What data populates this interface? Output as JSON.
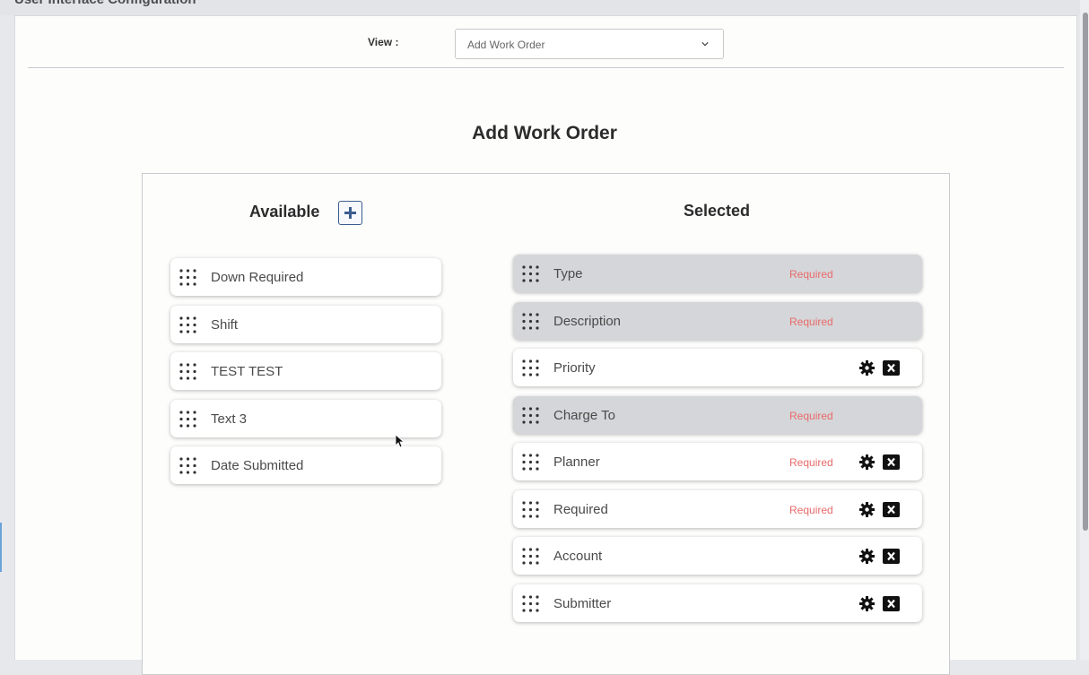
{
  "section": {
    "title": "User Interface Configuration"
  },
  "view": {
    "label": "View :",
    "selected": "Add Work Order"
  },
  "page_title": "Add Work Order",
  "available": {
    "title": "Available",
    "items": [
      {
        "label": "Down Required"
      },
      {
        "label": "Shift"
      },
      {
        "label": "TEST TEST"
      },
      {
        "label": "Text 3"
      },
      {
        "label": "Date Submitted"
      }
    ]
  },
  "selected": {
    "title": "Selected",
    "required_label": "Required",
    "items": [
      {
        "label": "Type",
        "required": true,
        "locked": true
      },
      {
        "label": "Description",
        "required": true,
        "locked": true
      },
      {
        "label": "Priority",
        "required": false,
        "locked": false
      },
      {
        "label": "Charge To",
        "required": true,
        "locked": true
      },
      {
        "label": "Planner",
        "required": true,
        "locked": false
      },
      {
        "label": "Required",
        "required": true,
        "locked": false
      },
      {
        "label": "Account",
        "required": false,
        "locked": false
      },
      {
        "label": "Submitter",
        "required": false,
        "locked": false
      }
    ]
  },
  "icons": {
    "add": "plus-icon",
    "grip": "drag-handle-icon",
    "settings": "gear-icon",
    "remove": "close-box-icon",
    "dropdown": "chevron-down-icon"
  },
  "colors": {
    "required_text": "#e86a6a",
    "accent": "#3a5d8f",
    "locked_card": "#d5d6d9"
  }
}
